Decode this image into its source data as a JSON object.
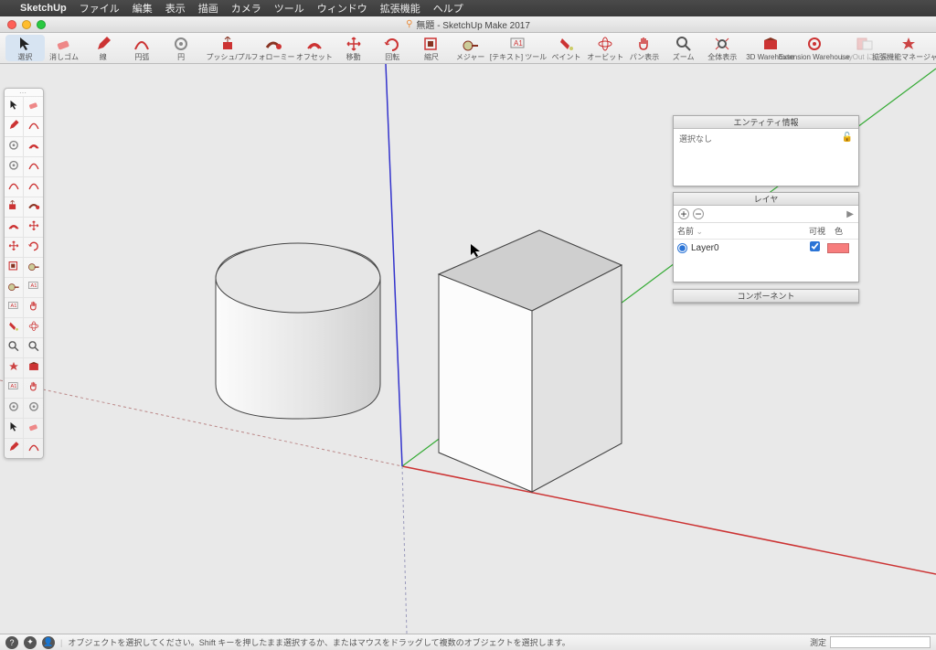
{
  "menubar": {
    "app": "SketchUp",
    "items": [
      "ファイル",
      "編集",
      "表示",
      "描画",
      "カメラ",
      "ツール",
      "ウィンドウ",
      "拡張機能",
      "ヘルプ"
    ]
  },
  "window_title": "無題 - SketchUp Make 2017",
  "toolbar": [
    {
      "label": "選択",
      "icon": "cursor",
      "sel": true
    },
    {
      "label": "消しゴム",
      "icon": "eraser"
    },
    {
      "label": "線",
      "icon": "pencil"
    },
    {
      "label": "円弧",
      "icon": "arc"
    },
    {
      "label": "円",
      "icon": "circle"
    },
    {
      "label": "プッシュ/プル",
      "icon": "pushpull"
    },
    {
      "label": "フォローミー",
      "icon": "followme"
    },
    {
      "label": "オフセット",
      "icon": "offset"
    },
    {
      "label": "移動",
      "icon": "move"
    },
    {
      "label": "回転",
      "icon": "rotate"
    },
    {
      "label": "縮尺",
      "icon": "scale"
    },
    {
      "label": "メジャー",
      "icon": "tape"
    },
    {
      "label": "[テキスト] ツール",
      "icon": "text"
    },
    {
      "label": "ペイント",
      "icon": "paint"
    },
    {
      "label": "オービット",
      "icon": "orbit"
    },
    {
      "label": "パン表示",
      "icon": "pan"
    },
    {
      "label": "ズーム",
      "icon": "zoom"
    },
    {
      "label": "全体表示",
      "icon": "zoomext"
    },
    {
      "label": "3D Warehouse",
      "icon": "3dw"
    },
    {
      "label": "Extension Warehouse",
      "icon": "ew"
    },
    {
      "label": "LayOut に送信",
      "icon": "layout",
      "disabled": true
    },
    {
      "label": "拡張機能マネージャー",
      "icon": "extman"
    }
  ],
  "panels": {
    "entity": {
      "title": "エンティティ情報",
      "status": "選択なし"
    },
    "layers": {
      "title": "レイヤ",
      "cols": {
        "name": "名前",
        "vis": "可視",
        "color": "色"
      },
      "rows": [
        {
          "name": "Layer0",
          "active": true,
          "visible": true,
          "color": "#f77d7d"
        }
      ]
    },
    "components": {
      "title": "コンポーネント"
    }
  },
  "statusbar": {
    "hint": "オブジェクトを選択してください。Shift キーを押したまま選択するか、またはマウスをドラッグして複数のオブジェクトを選択します。",
    "measure_label": "測定"
  }
}
